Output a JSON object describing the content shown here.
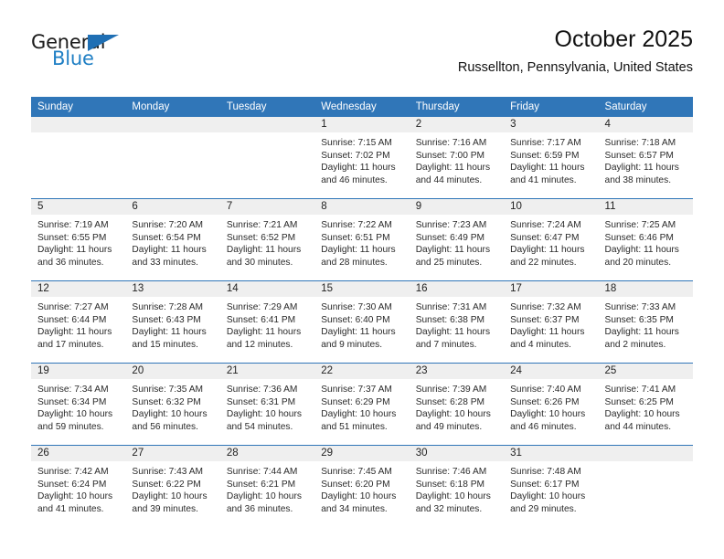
{
  "brand": {
    "name_part1": "General",
    "name_part2": "Blue",
    "triangle_icon": "triangle-icon",
    "accent_color": "#1f6fb4"
  },
  "header": {
    "title": "October 2025",
    "subtitle": "Russellton, Pennsylvania, United States"
  },
  "theme": {
    "header_row_bg": "#3076b8",
    "daynum_band_bg": "#efefef",
    "row_divider": "#3076b8",
    "text": "#2a2a2a"
  },
  "weekday_headers": [
    "Sunday",
    "Monday",
    "Tuesday",
    "Wednesday",
    "Thursday",
    "Friday",
    "Saturday"
  ],
  "weeks": [
    [
      {
        "day": "",
        "empty": true,
        "sunrise": "",
        "sunset": "",
        "daylight_line1": "",
        "daylight_line2": ""
      },
      {
        "day": "",
        "empty": true,
        "sunrise": "",
        "sunset": "",
        "daylight_line1": "",
        "daylight_line2": ""
      },
      {
        "day": "",
        "empty": true,
        "sunrise": "",
        "sunset": "",
        "daylight_line1": "",
        "daylight_line2": ""
      },
      {
        "day": "1",
        "empty": false,
        "sunrise": "Sunrise: 7:15 AM",
        "sunset": "Sunset: 7:02 PM",
        "daylight_line1": "Daylight: 11 hours",
        "daylight_line2": "and 46 minutes."
      },
      {
        "day": "2",
        "empty": false,
        "sunrise": "Sunrise: 7:16 AM",
        "sunset": "Sunset: 7:00 PM",
        "daylight_line1": "Daylight: 11 hours",
        "daylight_line2": "and 44 minutes."
      },
      {
        "day": "3",
        "empty": false,
        "sunrise": "Sunrise: 7:17 AM",
        "sunset": "Sunset: 6:59 PM",
        "daylight_line1": "Daylight: 11 hours",
        "daylight_line2": "and 41 minutes."
      },
      {
        "day": "4",
        "empty": false,
        "sunrise": "Sunrise: 7:18 AM",
        "sunset": "Sunset: 6:57 PM",
        "daylight_line1": "Daylight: 11 hours",
        "daylight_line2": "and 38 minutes."
      }
    ],
    [
      {
        "day": "5",
        "empty": false,
        "sunrise": "Sunrise: 7:19 AM",
        "sunset": "Sunset: 6:55 PM",
        "daylight_line1": "Daylight: 11 hours",
        "daylight_line2": "and 36 minutes."
      },
      {
        "day": "6",
        "empty": false,
        "sunrise": "Sunrise: 7:20 AM",
        "sunset": "Sunset: 6:54 PM",
        "daylight_line1": "Daylight: 11 hours",
        "daylight_line2": "and 33 minutes."
      },
      {
        "day": "7",
        "empty": false,
        "sunrise": "Sunrise: 7:21 AM",
        "sunset": "Sunset: 6:52 PM",
        "daylight_line1": "Daylight: 11 hours",
        "daylight_line2": "and 30 minutes."
      },
      {
        "day": "8",
        "empty": false,
        "sunrise": "Sunrise: 7:22 AM",
        "sunset": "Sunset: 6:51 PM",
        "daylight_line1": "Daylight: 11 hours",
        "daylight_line2": "and 28 minutes."
      },
      {
        "day": "9",
        "empty": false,
        "sunrise": "Sunrise: 7:23 AM",
        "sunset": "Sunset: 6:49 PM",
        "daylight_line1": "Daylight: 11 hours",
        "daylight_line2": "and 25 minutes."
      },
      {
        "day": "10",
        "empty": false,
        "sunrise": "Sunrise: 7:24 AM",
        "sunset": "Sunset: 6:47 PM",
        "daylight_line1": "Daylight: 11 hours",
        "daylight_line2": "and 22 minutes."
      },
      {
        "day": "11",
        "empty": false,
        "sunrise": "Sunrise: 7:25 AM",
        "sunset": "Sunset: 6:46 PM",
        "daylight_line1": "Daylight: 11 hours",
        "daylight_line2": "and 20 minutes."
      }
    ],
    [
      {
        "day": "12",
        "empty": false,
        "sunrise": "Sunrise: 7:27 AM",
        "sunset": "Sunset: 6:44 PM",
        "daylight_line1": "Daylight: 11 hours",
        "daylight_line2": "and 17 minutes."
      },
      {
        "day": "13",
        "empty": false,
        "sunrise": "Sunrise: 7:28 AM",
        "sunset": "Sunset: 6:43 PM",
        "daylight_line1": "Daylight: 11 hours",
        "daylight_line2": "and 15 minutes."
      },
      {
        "day": "14",
        "empty": false,
        "sunrise": "Sunrise: 7:29 AM",
        "sunset": "Sunset: 6:41 PM",
        "daylight_line1": "Daylight: 11 hours",
        "daylight_line2": "and 12 minutes."
      },
      {
        "day": "15",
        "empty": false,
        "sunrise": "Sunrise: 7:30 AM",
        "sunset": "Sunset: 6:40 PM",
        "daylight_line1": "Daylight: 11 hours",
        "daylight_line2": "and 9 minutes."
      },
      {
        "day": "16",
        "empty": false,
        "sunrise": "Sunrise: 7:31 AM",
        "sunset": "Sunset: 6:38 PM",
        "daylight_line1": "Daylight: 11 hours",
        "daylight_line2": "and 7 minutes."
      },
      {
        "day": "17",
        "empty": false,
        "sunrise": "Sunrise: 7:32 AM",
        "sunset": "Sunset: 6:37 PM",
        "daylight_line1": "Daylight: 11 hours",
        "daylight_line2": "and 4 minutes."
      },
      {
        "day": "18",
        "empty": false,
        "sunrise": "Sunrise: 7:33 AM",
        "sunset": "Sunset: 6:35 PM",
        "daylight_line1": "Daylight: 11 hours",
        "daylight_line2": "and 2 minutes."
      }
    ],
    [
      {
        "day": "19",
        "empty": false,
        "sunrise": "Sunrise: 7:34 AM",
        "sunset": "Sunset: 6:34 PM",
        "daylight_line1": "Daylight: 10 hours",
        "daylight_line2": "and 59 minutes."
      },
      {
        "day": "20",
        "empty": false,
        "sunrise": "Sunrise: 7:35 AM",
        "sunset": "Sunset: 6:32 PM",
        "daylight_line1": "Daylight: 10 hours",
        "daylight_line2": "and 56 minutes."
      },
      {
        "day": "21",
        "empty": false,
        "sunrise": "Sunrise: 7:36 AM",
        "sunset": "Sunset: 6:31 PM",
        "daylight_line1": "Daylight: 10 hours",
        "daylight_line2": "and 54 minutes."
      },
      {
        "day": "22",
        "empty": false,
        "sunrise": "Sunrise: 7:37 AM",
        "sunset": "Sunset: 6:29 PM",
        "daylight_line1": "Daylight: 10 hours",
        "daylight_line2": "and 51 minutes."
      },
      {
        "day": "23",
        "empty": false,
        "sunrise": "Sunrise: 7:39 AM",
        "sunset": "Sunset: 6:28 PM",
        "daylight_line1": "Daylight: 10 hours",
        "daylight_line2": "and 49 minutes."
      },
      {
        "day": "24",
        "empty": false,
        "sunrise": "Sunrise: 7:40 AM",
        "sunset": "Sunset: 6:26 PM",
        "daylight_line1": "Daylight: 10 hours",
        "daylight_line2": "and 46 minutes."
      },
      {
        "day": "25",
        "empty": false,
        "sunrise": "Sunrise: 7:41 AM",
        "sunset": "Sunset: 6:25 PM",
        "daylight_line1": "Daylight: 10 hours",
        "daylight_line2": "and 44 minutes."
      }
    ],
    [
      {
        "day": "26",
        "empty": false,
        "sunrise": "Sunrise: 7:42 AM",
        "sunset": "Sunset: 6:24 PM",
        "daylight_line1": "Daylight: 10 hours",
        "daylight_line2": "and 41 minutes."
      },
      {
        "day": "27",
        "empty": false,
        "sunrise": "Sunrise: 7:43 AM",
        "sunset": "Sunset: 6:22 PM",
        "daylight_line1": "Daylight: 10 hours",
        "daylight_line2": "and 39 minutes."
      },
      {
        "day": "28",
        "empty": false,
        "sunrise": "Sunrise: 7:44 AM",
        "sunset": "Sunset: 6:21 PM",
        "daylight_line1": "Daylight: 10 hours",
        "daylight_line2": "and 36 minutes."
      },
      {
        "day": "29",
        "empty": false,
        "sunrise": "Sunrise: 7:45 AM",
        "sunset": "Sunset: 6:20 PM",
        "daylight_line1": "Daylight: 10 hours",
        "daylight_line2": "and 34 minutes."
      },
      {
        "day": "30",
        "empty": false,
        "sunrise": "Sunrise: 7:46 AM",
        "sunset": "Sunset: 6:18 PM",
        "daylight_line1": "Daylight: 10 hours",
        "daylight_line2": "and 32 minutes."
      },
      {
        "day": "31",
        "empty": false,
        "sunrise": "Sunrise: 7:48 AM",
        "sunset": "Sunset: 6:17 PM",
        "daylight_line1": "Daylight: 10 hours",
        "daylight_line2": "and 29 minutes."
      },
      {
        "day": "",
        "empty": true,
        "sunrise": "",
        "sunset": "",
        "daylight_line1": "",
        "daylight_line2": ""
      }
    ]
  ]
}
